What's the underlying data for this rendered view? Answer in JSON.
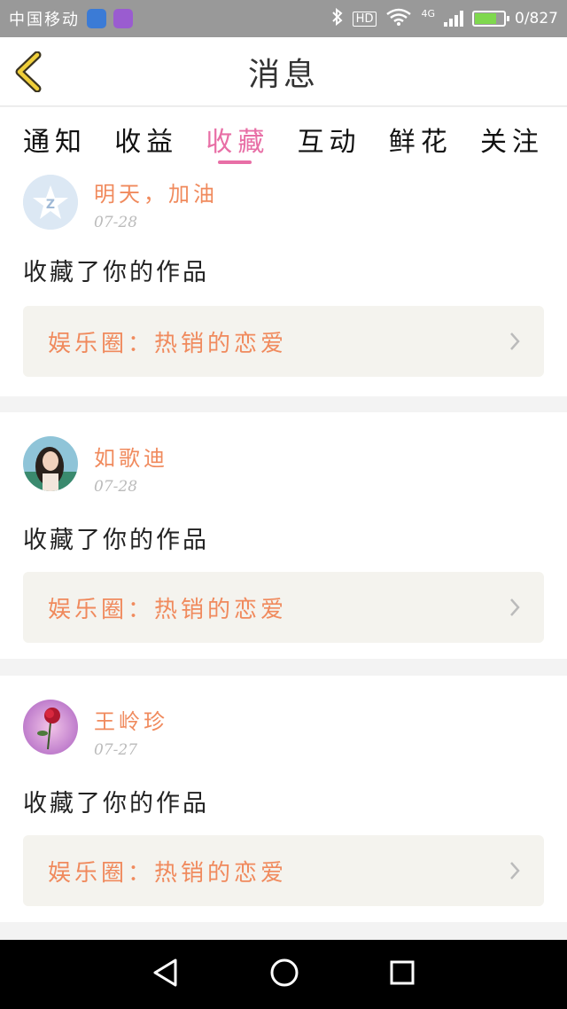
{
  "status_bar": {
    "carrier": "中国移动",
    "network": "4G",
    "hd": "HD",
    "data_rate": "0/827"
  },
  "header": {
    "title": "消息",
    "back_icon": "chevron-left-icon"
  },
  "tabs": [
    {
      "label": "通知",
      "active": false
    },
    {
      "label": "收益",
      "active": false
    },
    {
      "label": "收藏",
      "active": true
    },
    {
      "label": "互动",
      "active": false
    },
    {
      "label": "鲜花",
      "active": false
    },
    {
      "label": "关注",
      "active": false
    }
  ],
  "messages": [
    {
      "user": "明天，加油",
      "date": "07-28",
      "action": "收藏了你的作品",
      "work": "娱乐圈：热销的恋爱",
      "avatar": "default-qq-avatar"
    },
    {
      "user": "如歌迪",
      "date": "07-28",
      "action": "收藏了你的作品",
      "work": "娱乐圈：热销的恋爱",
      "avatar": "photo-avatar"
    },
    {
      "user": "王岭珍",
      "date": "07-27",
      "action": "收藏了你的作品",
      "work": "娱乐圈：热销的恋爱",
      "avatar": "rose-avatar"
    }
  ],
  "colors": {
    "accent": "#e86fa6",
    "username": "#f08a5d",
    "card_bg": "#f4f3ee"
  },
  "nav_bar": {
    "back": "back-triangle-icon",
    "home": "home-circle-icon",
    "recents": "recents-square-icon"
  }
}
